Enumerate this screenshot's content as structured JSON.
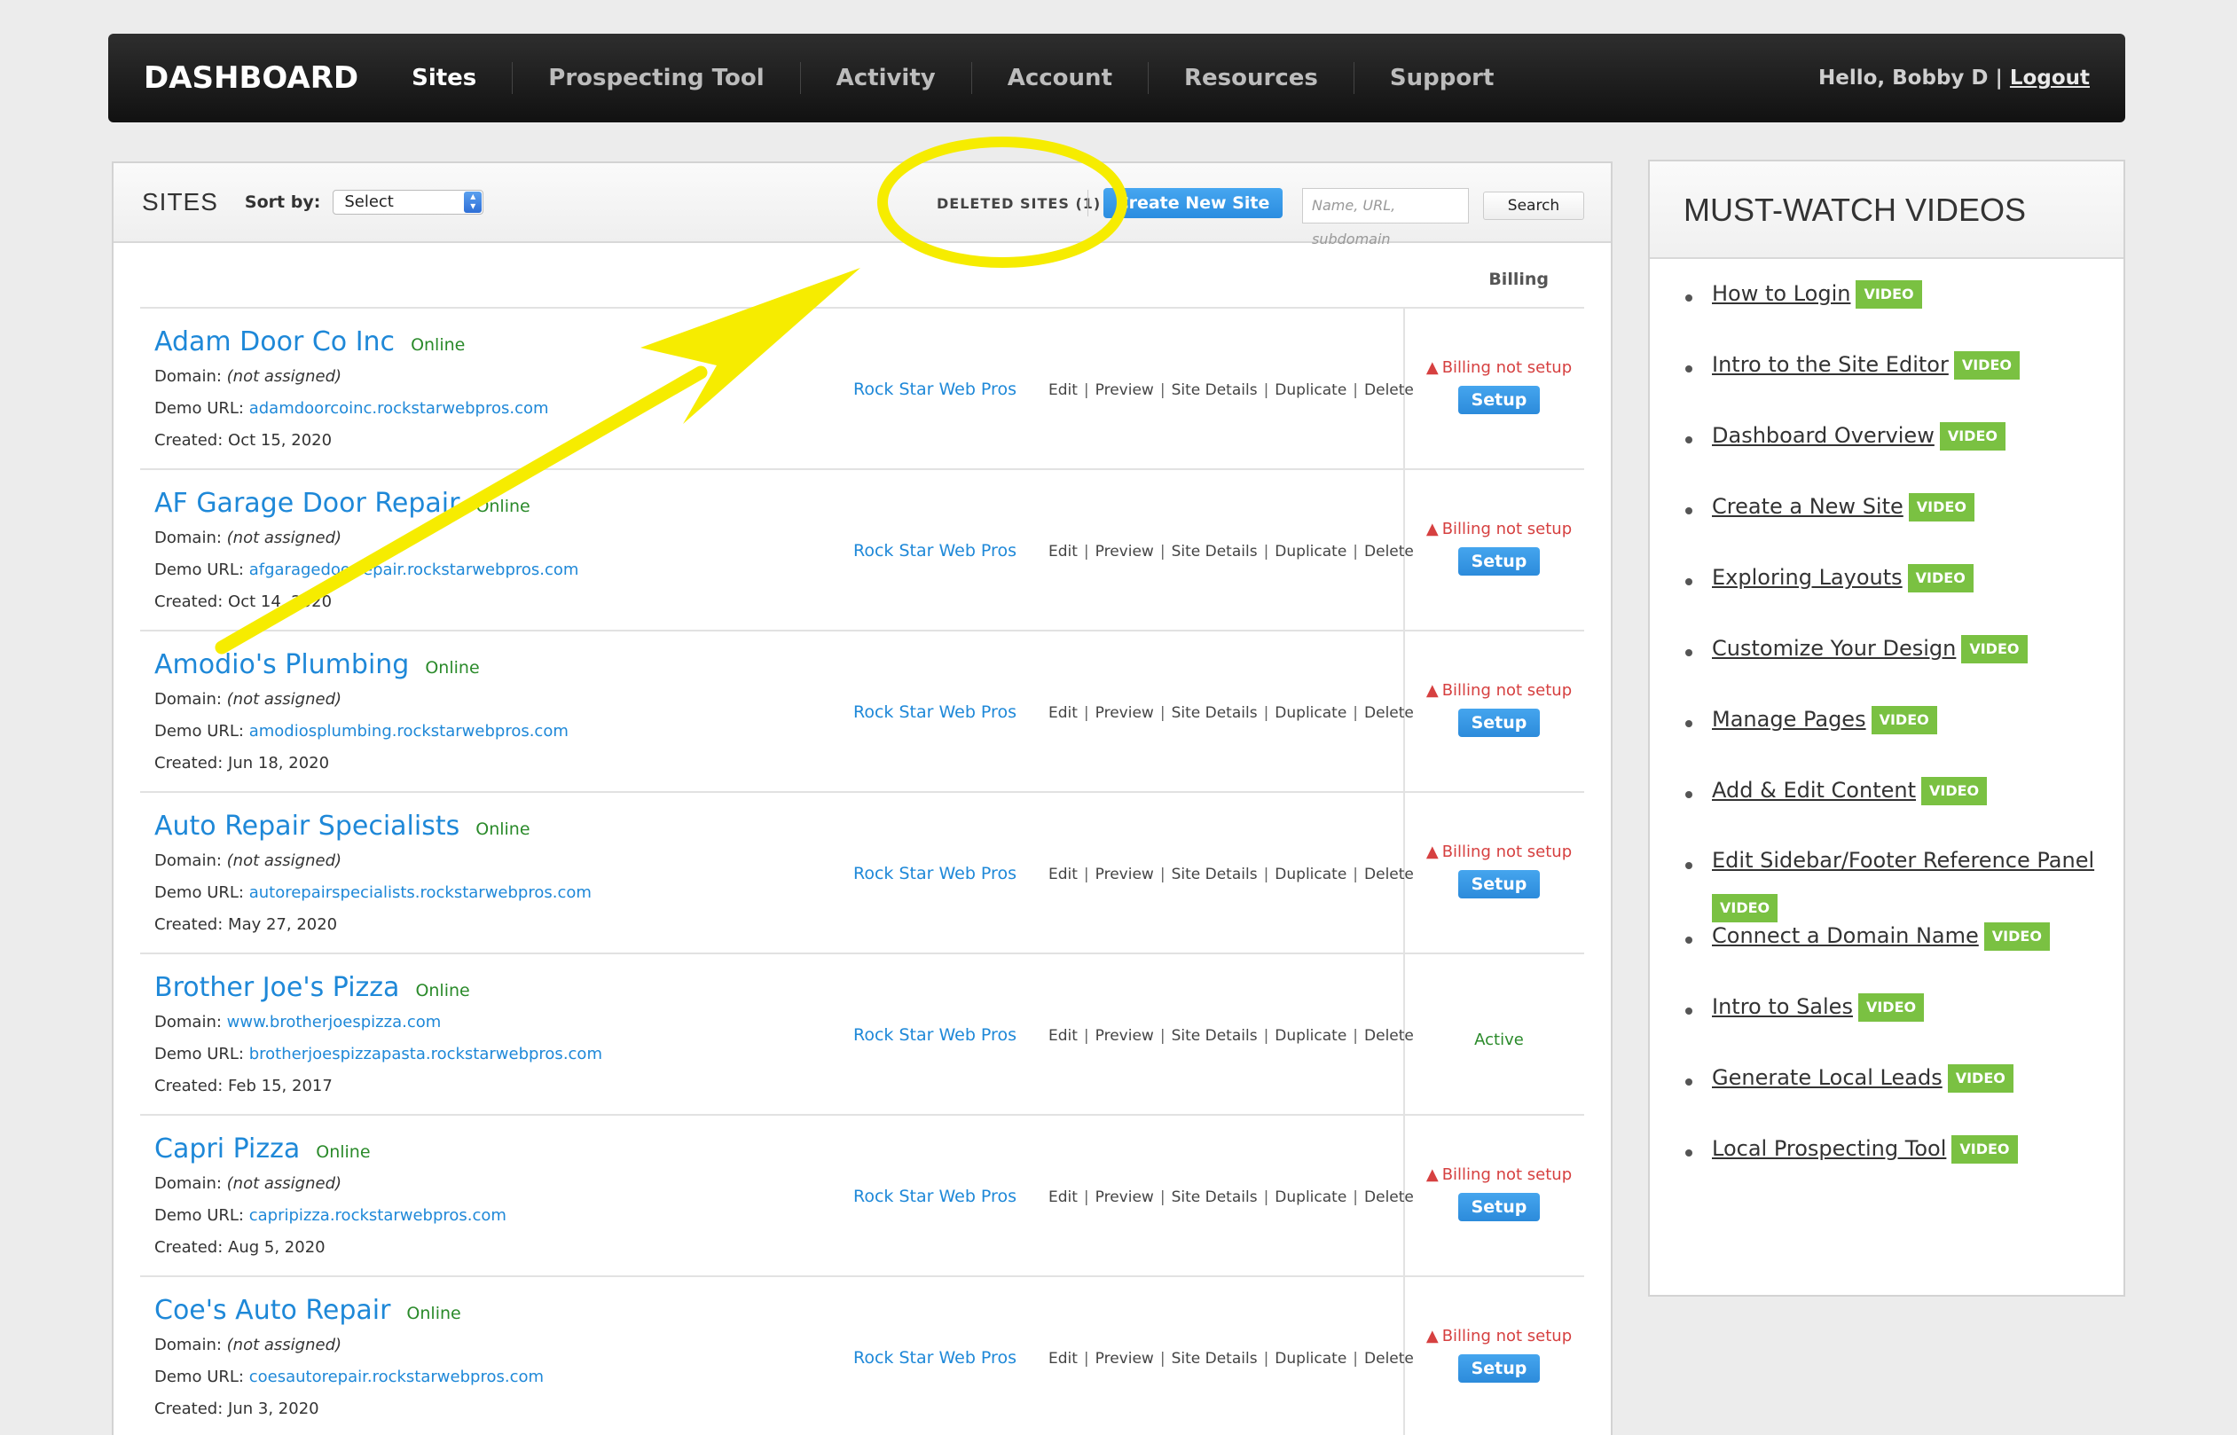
{
  "nav": {
    "brand": "DASHBOARD",
    "items": [
      {
        "label": "Sites"
      },
      {
        "label": "Prospecting Tool"
      },
      {
        "label": "Activity"
      },
      {
        "label": "Account"
      },
      {
        "label": "Resources"
      },
      {
        "label": "Support"
      }
    ],
    "greeting": "Hello, Bobby D",
    "separator": "|",
    "logout": "Logout"
  },
  "sites": {
    "title": "SITES",
    "sort_label": "Sort by:",
    "sort_value": "Select",
    "deleted_label": "DELETED SITES (1)",
    "create_label": "Create New Site",
    "search_placeholder": "Name, URL, subdomain",
    "search_label": "Search",
    "billing_header": "Billing",
    "labels": {
      "domain": "Domain:",
      "demo": "Demo URL:",
      "created": "Created:",
      "not_assigned": "(not assigned)",
      "billing_warn": "Billing not setup",
      "setup": "Setup",
      "actions": [
        "Edit",
        "Preview",
        "Site Details",
        "Duplicate",
        "Delete"
      ]
    },
    "rows": [
      {
        "name": "Adam Door Co Inc",
        "status": "Online",
        "domain": "",
        "demo": "adamdoorcoinc.rockstarwebpros.com",
        "created": "Oct 15, 2020",
        "owner": "Rock Star Web Pros",
        "billing": "warn"
      },
      {
        "name": "AF Garage Door Repair",
        "status": "Online",
        "domain": "",
        "demo": "afgaragedoorrepair.rockstarwebpros.com",
        "created": "Oct 14, 2020",
        "owner": "Rock Star Web Pros",
        "billing": "warn"
      },
      {
        "name": "Amodio's Plumbing",
        "status": "Online",
        "domain": "",
        "demo": "amodiosplumbing.rockstarwebpros.com",
        "created": "Jun 18, 2020",
        "owner": "Rock Star Web Pros",
        "billing": "warn"
      },
      {
        "name": "Auto Repair Specialists",
        "status": "Online",
        "domain": "",
        "demo": "autorepairspecialists.rockstarwebpros.com",
        "created": "May 27, 2020",
        "owner": "Rock Star Web Pros",
        "billing": "warn"
      },
      {
        "name": "Brother Joe's Pizza",
        "status": "Online",
        "domain": "www.brotherjoespizza.com",
        "demo": "brotherjoespizzapasta.rockstarwebpros.com",
        "created": "Feb 15, 2017",
        "owner": "Rock Star Web Pros",
        "billing": "Active"
      },
      {
        "name": "Capri Pizza",
        "status": "Online",
        "domain": "",
        "demo": "capripizza.rockstarwebpros.com",
        "created": "Aug 5, 2020",
        "owner": "Rock Star Web Pros",
        "billing": "warn"
      },
      {
        "name": "Coe's Auto Repair",
        "status": "Online",
        "domain": "",
        "demo": "coesautorepair.rockstarwebpros.com",
        "created": "Jun 3, 2020",
        "owner": "Rock Star Web Pros",
        "billing": "warn"
      }
    ]
  },
  "videos": {
    "title": "MUST-WATCH VIDEOS",
    "badge": "VIDEO",
    "items": [
      "How to Login",
      "Intro to the Site Editor",
      "Dashboard Overview",
      "Create a New Site",
      "Exploring Layouts",
      "Customize Your Design",
      "Manage Pages",
      "Add & Edit Content",
      "Edit Sidebar/Footer Reference Panel",
      "Connect a Domain Name",
      "Intro to Sales",
      "Generate Local Leads",
      "Local Prospecting Tool"
    ]
  },
  "colors": {
    "link": "#1e88d8",
    "online": "#2a8a2a",
    "warn": "#d64040",
    "badge": "#7ac142",
    "annotation": "#f6ec00"
  }
}
